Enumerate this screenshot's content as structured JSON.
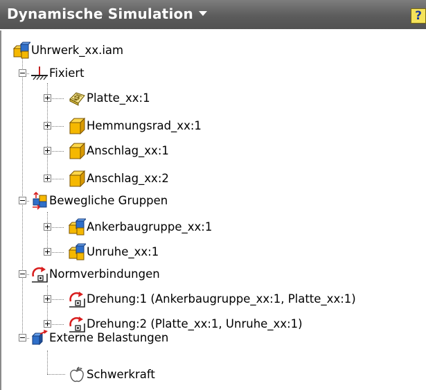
{
  "panel": {
    "title": "Dynamische Simulation",
    "help_glyph": "?"
  },
  "tree": {
    "root": {
      "label": "Uhrwerk_xx.iam",
      "icon": "assembly-icon"
    },
    "groups": [
      {
        "label": "Fixiert",
        "icon": "ground-icon",
        "expanded": true,
        "children": [
          {
            "label": "Platte_xx:1",
            "icon": "surface-part-icon"
          },
          {
            "label": "Hemmungsrad_xx:1",
            "icon": "part-icon"
          },
          {
            "label": "Anschlag_xx:1",
            "icon": "part-icon"
          },
          {
            "label": "Anschlag_xx:2",
            "icon": "part-icon"
          }
        ]
      },
      {
        "label": "Bewegliche Gruppen",
        "icon": "mobile-groups-icon",
        "expanded": true,
        "children": [
          {
            "label": "Ankerbaugruppe_xx:1",
            "icon": "assembly-icon"
          },
          {
            "label": "Unruhe_xx:1",
            "icon": "assembly-icon"
          }
        ]
      },
      {
        "label": "Normverbindungen",
        "icon": "joint-icon",
        "expanded": true,
        "children": [
          {
            "label": "Drehung:1 (Ankerbaugruppe_xx:1, Platte_xx:1)",
            "icon": "revolution-joint-icon"
          },
          {
            "label": "Drehung:2 (Platte_xx:1, Unruhe_xx:1)",
            "icon": "revolution-joint-icon"
          }
        ]
      },
      {
        "label": "Externe Belastungen",
        "icon": "external-load-icon",
        "expanded": true,
        "children": [
          {
            "label": "Schwerkraft",
            "icon": "gravity-apple-icon"
          }
        ]
      }
    ]
  },
  "colors": {
    "header_bg": "#5c5c5c",
    "part_orange": "#f5b800",
    "joint_red": "#d81e1e",
    "assembly_blue": "#2f6fc9"
  }
}
